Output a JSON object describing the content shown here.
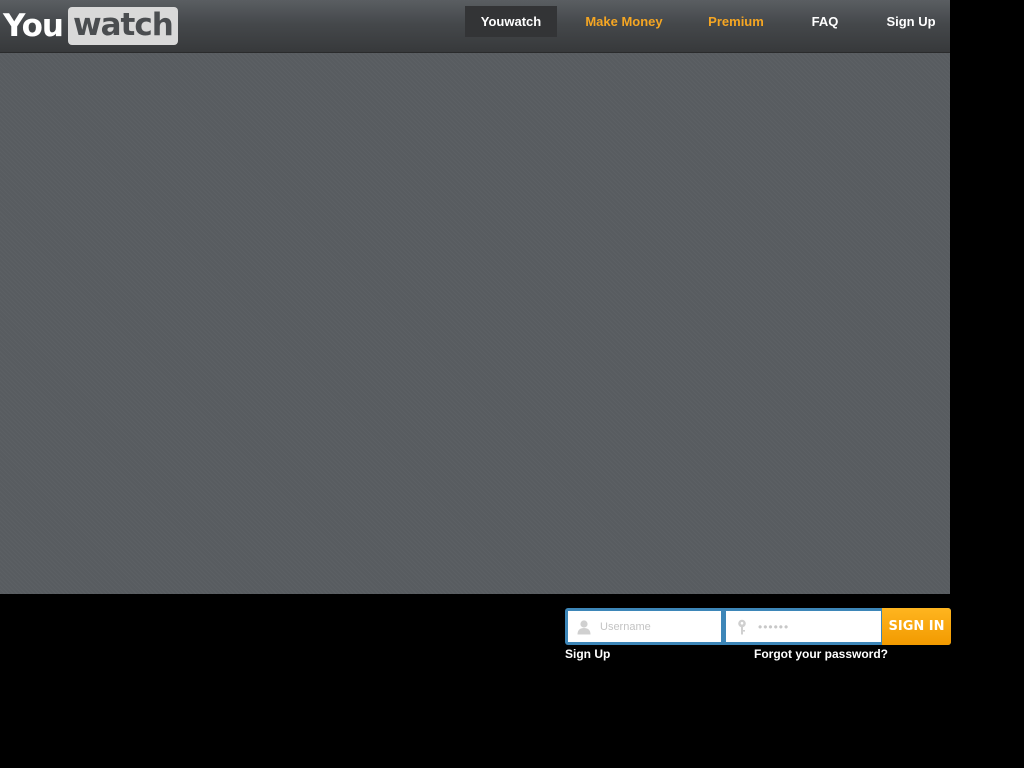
{
  "logo": {
    "part1": "You",
    "part2": "watch"
  },
  "nav": {
    "items": [
      {
        "label": "Youwatch",
        "active": true,
        "color": "#ffffff"
      },
      {
        "label": "Make Money",
        "active": false,
        "color": "#f5a623"
      },
      {
        "label": "Premium",
        "active": false,
        "color": "#f5a623"
      },
      {
        "label": "FAQ",
        "active": false,
        "color": "#ffffff"
      },
      {
        "label": "Sign Up",
        "active": false,
        "color": "#ffffff"
      }
    ]
  },
  "login": {
    "username_placeholder": "Username",
    "password_placeholder": "••••••",
    "signin_label": "SIGN IN",
    "signup_link": "Sign Up",
    "forgot_link": "Forgot your password?",
    "username_icon": "user-icon",
    "password_icon": "key-icon"
  },
  "colors": {
    "accent": "#f5a623",
    "login_border": "#3d86b8",
    "main_bg": "#585c60"
  }
}
